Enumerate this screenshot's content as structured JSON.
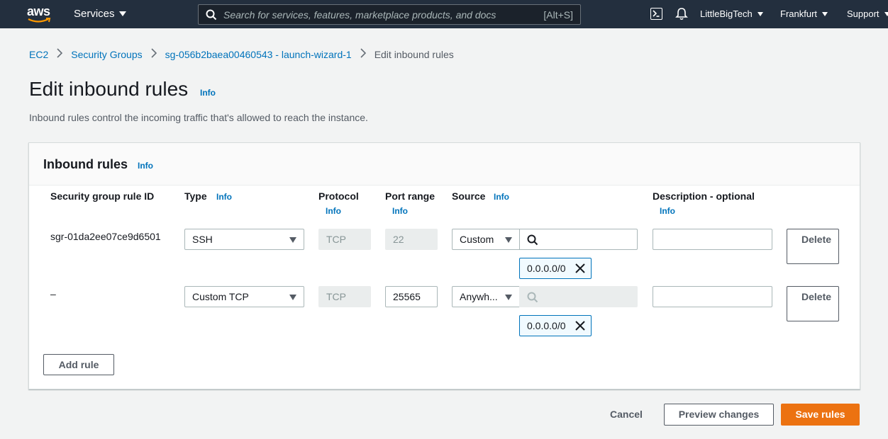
{
  "nav": {
    "logo_text": "aws",
    "services_label": "Services",
    "search_placeholder": "Search for services, features, marketplace products, and docs",
    "search_shortcut": "[Alt+S]",
    "account_label": "LittleBigTech",
    "region_label": "Frankfurt",
    "support_label": "Support"
  },
  "breadcrumb": {
    "items": [
      "EC2",
      "Security Groups",
      "sg-056b2baea00460543 - launch-wizard-1"
    ],
    "current": "Edit inbound rules"
  },
  "page": {
    "title": "Edit inbound rules",
    "title_info": "Info",
    "subtitle": "Inbound rules control the incoming traffic that's allowed to reach the instance."
  },
  "panel": {
    "title": "Inbound rules",
    "info": "Info",
    "columns": {
      "rule_id": "Security group rule ID",
      "type": "Type",
      "protocol": "Protocol",
      "port_range": "Port range",
      "source": "Source",
      "description": "Description - optional",
      "info": "Info"
    },
    "rows": [
      {
        "rule_id": "sgr-01da2ee07ce9d6501",
        "type": "SSH",
        "protocol": "TCP",
        "port_range": "22",
        "source_type": "Custom",
        "source_search": "",
        "cidr_token": "0.0.0.0/0",
        "description": "",
        "delete_label": "Delete"
      },
      {
        "rule_id": "–",
        "type": "Custom TCP",
        "protocol": "TCP",
        "port_range": "25565",
        "source_type": "Anywh...",
        "source_search": "",
        "cidr_token": "0.0.0.0/0",
        "description": "",
        "delete_label": "Delete"
      }
    ],
    "add_rule_label": "Add rule"
  },
  "footer": {
    "cancel_label": "Cancel",
    "preview_label": "Preview changes",
    "save_label": "Save rules"
  },
  "colors": {
    "nav_bg": "#232f3e",
    "link": "#0073bb",
    "primary": "#ec7211"
  }
}
